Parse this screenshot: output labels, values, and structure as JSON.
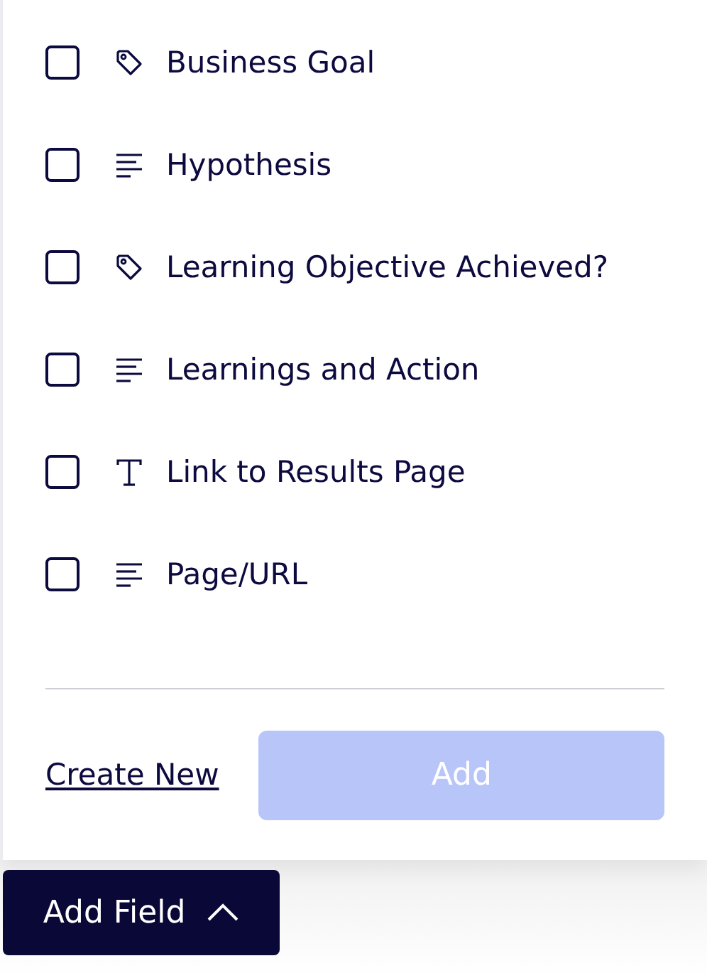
{
  "fields": [
    {
      "kind": "tag",
      "label": "Business Goal",
      "checked": false
    },
    {
      "kind": "paragraph",
      "label": "Hypothesis",
      "checked": false
    },
    {
      "kind": "tag",
      "label": "Learning Objective Achieved?",
      "checked": false
    },
    {
      "kind": "paragraph",
      "label": "Learnings and Action",
      "checked": false
    },
    {
      "kind": "text",
      "label": "Link to Results Page",
      "checked": false
    },
    {
      "kind": "paragraph",
      "label": "Page/URL",
      "checked": false
    }
  ],
  "create_link": "Create New",
  "add_button": {
    "label": "Add",
    "disabled": true
  },
  "add_field_button": {
    "label": "Add Field",
    "expanded": true
  }
}
